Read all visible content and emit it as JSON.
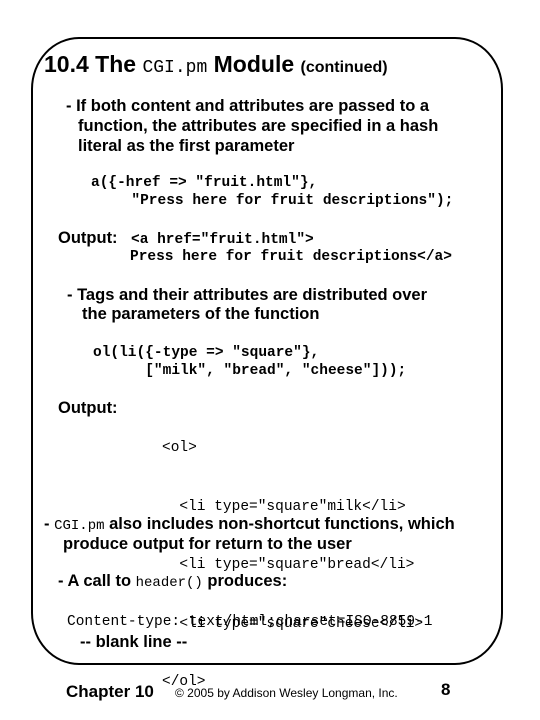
{
  "slide": {
    "title": {
      "prefix": "10.4 The ",
      "code": "CGI.pm",
      "suffix": " Module ",
      "note": "(continued)"
    },
    "bullet1": {
      "lines": [
        "- If both content and attributes are passed to a",
        "function, the attributes are specified in a hash",
        "literal as the first parameter"
      ]
    },
    "code1": {
      "lines": [
        "a({-href => \"fruit.html\"},",
        "  \"Press here for fruit descriptions\");"
      ]
    },
    "output1": {
      "label": "Output:",
      "lines": [
        "<a href=\"fruit.html\">",
        "Press here for fruit descriptions</a>"
      ]
    },
    "bullet2": {
      "lines": [
        "- Tags and their attributes are distributed over",
        "the parameters of the function"
      ]
    },
    "code2": {
      "lines": [
        "ol(li({-type => \"square\"},",
        "      [\"milk\", \"bread\", \"cheese\"]));"
      ]
    },
    "output2": {
      "label": "Output:",
      "lines": [
        "<ol>",
        "  <li type=\"square\"milk</li>",
        "  <li type=\"square\"bread</li>",
        "  <li type=\"square\"cheese</li>",
        "</ol>"
      ]
    },
    "bullet3": {
      "dash": "- ",
      "code": "CGI.pm",
      "text": " also includes non-shortcut functions, which",
      "line2": "produce output for return to the user"
    },
    "bullet4": {
      "prefix": "- A call to ",
      "code": "header()",
      "suffix": " produces:"
    },
    "header_output": {
      "line": "Content-type: text/html;charset=ISO-8859-1",
      "blank": "-- blank line --"
    }
  },
  "footer": {
    "chapter": "Chapter 10",
    "copyright": "© 2005 by Addison Wesley Longman, Inc.",
    "page": "8"
  }
}
